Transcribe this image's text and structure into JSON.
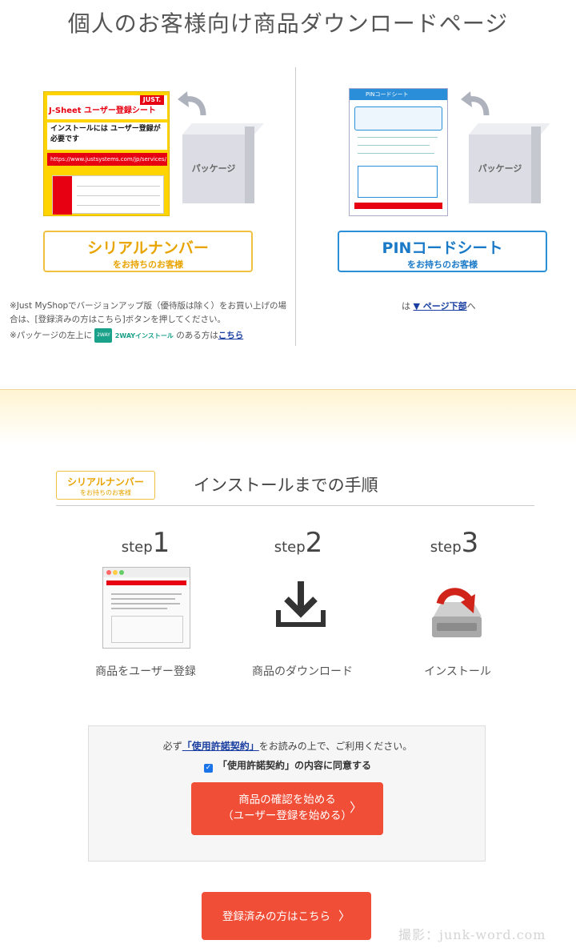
{
  "page_title": "個人のお客様向け商品ダウンロードページ",
  "serial": {
    "sheet_brand": "JUST.",
    "sheet_title": "J-Sheet ユーザー登録シート",
    "sheet_warning": "インストールには ユーザー登録が必要です",
    "sheet_url": "https://www.justsystems.com/jp/services/",
    "package_label": "パッケージ",
    "button_main": "シリアルナンバー",
    "button_sub": "をお持ちのお客様",
    "note1": "※Just MyShopでバージョンアップ版（優待版は除く）をお買い上げの場合は、[登録済みの方はこちら]ボタンを押してください。",
    "note2_prefix": "※パッケージの左上に",
    "twoway_badge": "2WAY",
    "twoway_text": "2WAYインストール",
    "note2_middle": "のある方は",
    "note2_link": "こちら"
  },
  "pin": {
    "sheet_title": "PINコードシート",
    "package_label": "パッケージ",
    "button_main": "PINコードシート",
    "button_sub": "をお持ちのお客様",
    "link_prefix": "は",
    "link_text": "▼ ページ下部",
    "link_suffix": "へ"
  },
  "steps": {
    "badge_main": "シリアルナンバー",
    "badge_sub": "をお持ちのお客様",
    "title": "インストールまでの手順",
    "step_word": "step",
    "items": [
      {
        "num": "1",
        "caption": "商品をユーザー登録"
      },
      {
        "num": "2",
        "caption": "商品のダウンロード"
      },
      {
        "num": "3",
        "caption": "インストール"
      }
    ]
  },
  "agree": {
    "text_prefix": "必ず",
    "license_link": "「使用許諾契約」",
    "text_suffix": "をお読みの上で、ご利用ください。",
    "checkbox_label": "「使用許諾契約」の内容に同意する",
    "checked": true,
    "start_line1": "商品の確認を始める",
    "start_line2": "（ユーザー登録を始める）"
  },
  "registered_button": "登録済みの方はこちら",
  "chevron": "〉",
  "watermark": "撮影：junk-word.com",
  "colors": {
    "accent_orange": "#f04e37",
    "serial_yellow": "#e8a400",
    "pin_blue": "#1a7ac8",
    "link": "#1a3fa0"
  }
}
